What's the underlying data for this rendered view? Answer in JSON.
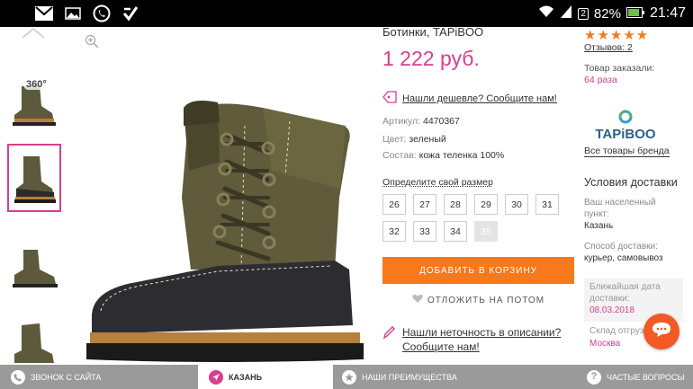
{
  "status_bar": {
    "battery": "82%",
    "time": "21:47",
    "sim_badge": "2",
    "icons": [
      "gmail-icon",
      "gallery-icon",
      "whatsapp-icon",
      "checkmark-app-icon",
      "wifi-icon",
      "signal-icon",
      "battery-icon"
    ]
  },
  "product": {
    "title": "Ботинки, TAPiBOO",
    "price": "1 222 руб.",
    "cheaper_link": "Нашли дешевле? Сообщите нам!",
    "article_label": "Артикул:",
    "article_value": "4470367",
    "color_label": "Цвет:",
    "color_value": "зеленый",
    "material_label": "Состав:",
    "material_value": "кожа теленка 100%",
    "size_label": "Определите свой размер",
    "sizes": [
      "26",
      "27",
      "28",
      "29",
      "30",
      "31",
      "32",
      "33",
      "34",
      "35"
    ],
    "unavailable_size": "35",
    "add_to_cart": "ДОБАВИТЬ В КОРЗИНУ",
    "save_later": "ОТЛОЖИТЬ НА ПОТОМ",
    "inaccuracy_line1": "Нашли неточность в описании?",
    "inaccuracy_line2": "Сообщите нам!",
    "thumb_badge": "360°"
  },
  "sidebar": {
    "stars": "★★★★★",
    "rating": 5,
    "reviews": "Отзывов: 2",
    "ordered_label": "Товар заказали:",
    "ordered_value": "64 раза",
    "brand_logo_text": "TAPiBOO",
    "brand_link": "Все товары бренда",
    "delivery_title": "Условия доставки",
    "city_label_1": "Ваш населенный",
    "city_label_2": "пункт:",
    "city_value": "Казань",
    "method_label": "Способ доставки:",
    "method_value": "курьер, самовывоз",
    "nearest_label_1": "Ближайшая дата",
    "nearest_label_2": "доставки:",
    "nearest_value": "08.03.2018",
    "warehouse_label": "Склад отгруз",
    "warehouse_value": "Москва"
  },
  "bottom_bar": {
    "call": "ЗВОНОК С САЙТА",
    "city": "КАЗАНЬ",
    "advantages": "НАШИ ПРЕИМУЩЕСТВА",
    "faq": "ЧАСТЫЕ ВОПРОСЫ"
  },
  "colors": {
    "accent_pink": "#d93e8c",
    "accent_orange": "#f7791b",
    "chat_orange": "#f15a24"
  }
}
